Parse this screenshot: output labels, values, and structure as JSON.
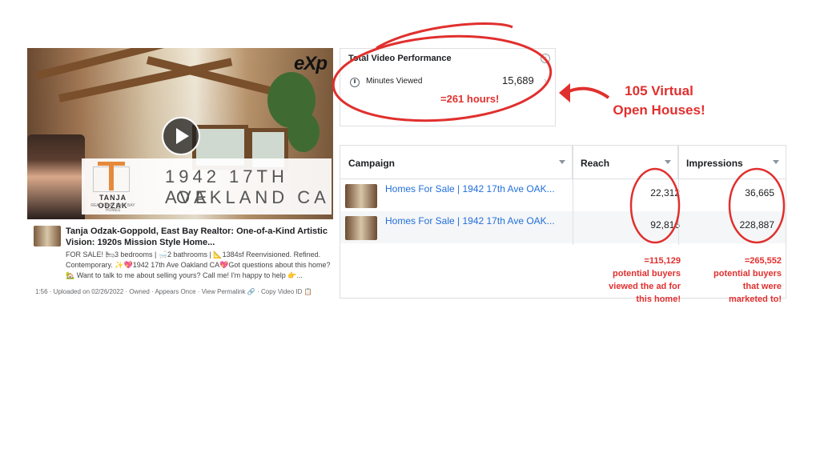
{
  "video_post": {
    "exp_logo": "eXp",
    "agent_name": "TANJA ODZAK",
    "agent_sub": "REALTOR® · EAST BAY HOMES",
    "address_line1": "1942 17TH AVE",
    "address_line2": "OAKLAND CA",
    "title": "Tanja Odzak-Goppold, East Bay Realtor: One-of-a-Kind Artistic Vision: 1920s Mission Style Home...",
    "description": "FOR SALE! 🛏3 bedrooms | 🛁2 bathrooms | 📐1384sf Reenvisioned. Refined. Contemporary. ✨💖1942 17th Ave Oakland CA💖Got questions about this home? 🏡 Want to talk to me about selling yours? Call me! I'm happy to help 👉...",
    "meta": "1:56 · Uploaded on 02/26/2022 · Owned · Appears Once · View Permalink 🔗 · Copy Video ID 📋"
  },
  "performance": {
    "title": "Total Video Performance",
    "info_glyph": "i",
    "minutes_label": "Minutes Viewed",
    "minutes_value": "15,689",
    "chevron": "›"
  },
  "table": {
    "headers": [
      "Campaign",
      "Reach",
      "Impressions"
    ],
    "rows": [
      {
        "name": "Homes For Sale | 1942 17th Ave OAK...",
        "reach": "22,312",
        "impressions": "36,665"
      },
      {
        "name": "Homes For Sale | 1942 17th Ave OAK...",
        "reach": "92,816",
        "impressions": "228,887"
      }
    ]
  },
  "annotations": {
    "hours": "=261 hours!",
    "open_houses_1": "105 Virtual",
    "open_houses_2": "Open Houses!",
    "reach_1": "=115,129",
    "reach_2": "potential buyers",
    "reach_3": "viewed the ad for",
    "reach_4": "this home!",
    "impr_1": "=265,552",
    "impr_2": "potential buyers",
    "impr_3": "that were",
    "impr_4": "marketed to!"
  },
  "colors": {
    "annotation_red": "#e0302e",
    "link_blue": "#216fdb",
    "border": "#dddfe2"
  }
}
